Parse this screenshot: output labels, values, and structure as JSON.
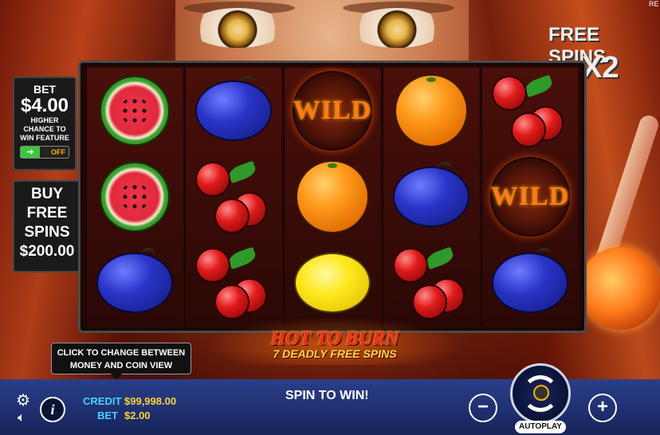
{
  "corner_text": "RE",
  "free_spins": {
    "label": "FREE SPINS",
    "multiplier": "X2"
  },
  "bet_panel": {
    "label": "BET",
    "amount": "$4.00",
    "desc_line1": "HIGHER",
    "desc_line2": "CHANCE TO",
    "desc_line3": "WIN FEATURE",
    "toggle_state": "OFF"
  },
  "buy_panel": {
    "line1": "BUY",
    "line2": "FREE",
    "line3": "SPINS",
    "price": "$200.00"
  },
  "reels": [
    [
      {
        "symbol": "watermelon"
      },
      {
        "symbol": "watermelon"
      },
      {
        "symbol": "plum"
      }
    ],
    [
      {
        "symbol": "plum"
      },
      {
        "symbol": "cherry"
      },
      {
        "symbol": "cherry"
      }
    ],
    [
      {
        "symbol": "wild",
        "text": "WILD"
      },
      {
        "symbol": "orange"
      },
      {
        "symbol": "lemon"
      }
    ],
    [
      {
        "symbol": "orange"
      },
      {
        "symbol": "plum"
      },
      {
        "symbol": "cherry"
      }
    ],
    [
      {
        "symbol": "cherry"
      },
      {
        "symbol": "wild",
        "text": "WILD"
      },
      {
        "symbol": "plum"
      }
    ]
  ],
  "logo": {
    "line1": "HOT TO BURN",
    "line2": "7 DEADLY FREE SPINS"
  },
  "tooltip": {
    "line1": "CLICK TO CHANGE BETWEEN",
    "line2": "MONEY AND COIN VIEW"
  },
  "bottom_bar": {
    "credit_label": "CREDIT",
    "credit_value": "$99,998.00",
    "bet_label": "BET",
    "bet_value": "$2.00",
    "message": "SPIN TO WIN!",
    "minus": "−",
    "plus": "+",
    "autoplay_label": "AUTOPLAY",
    "info_label": "i"
  }
}
